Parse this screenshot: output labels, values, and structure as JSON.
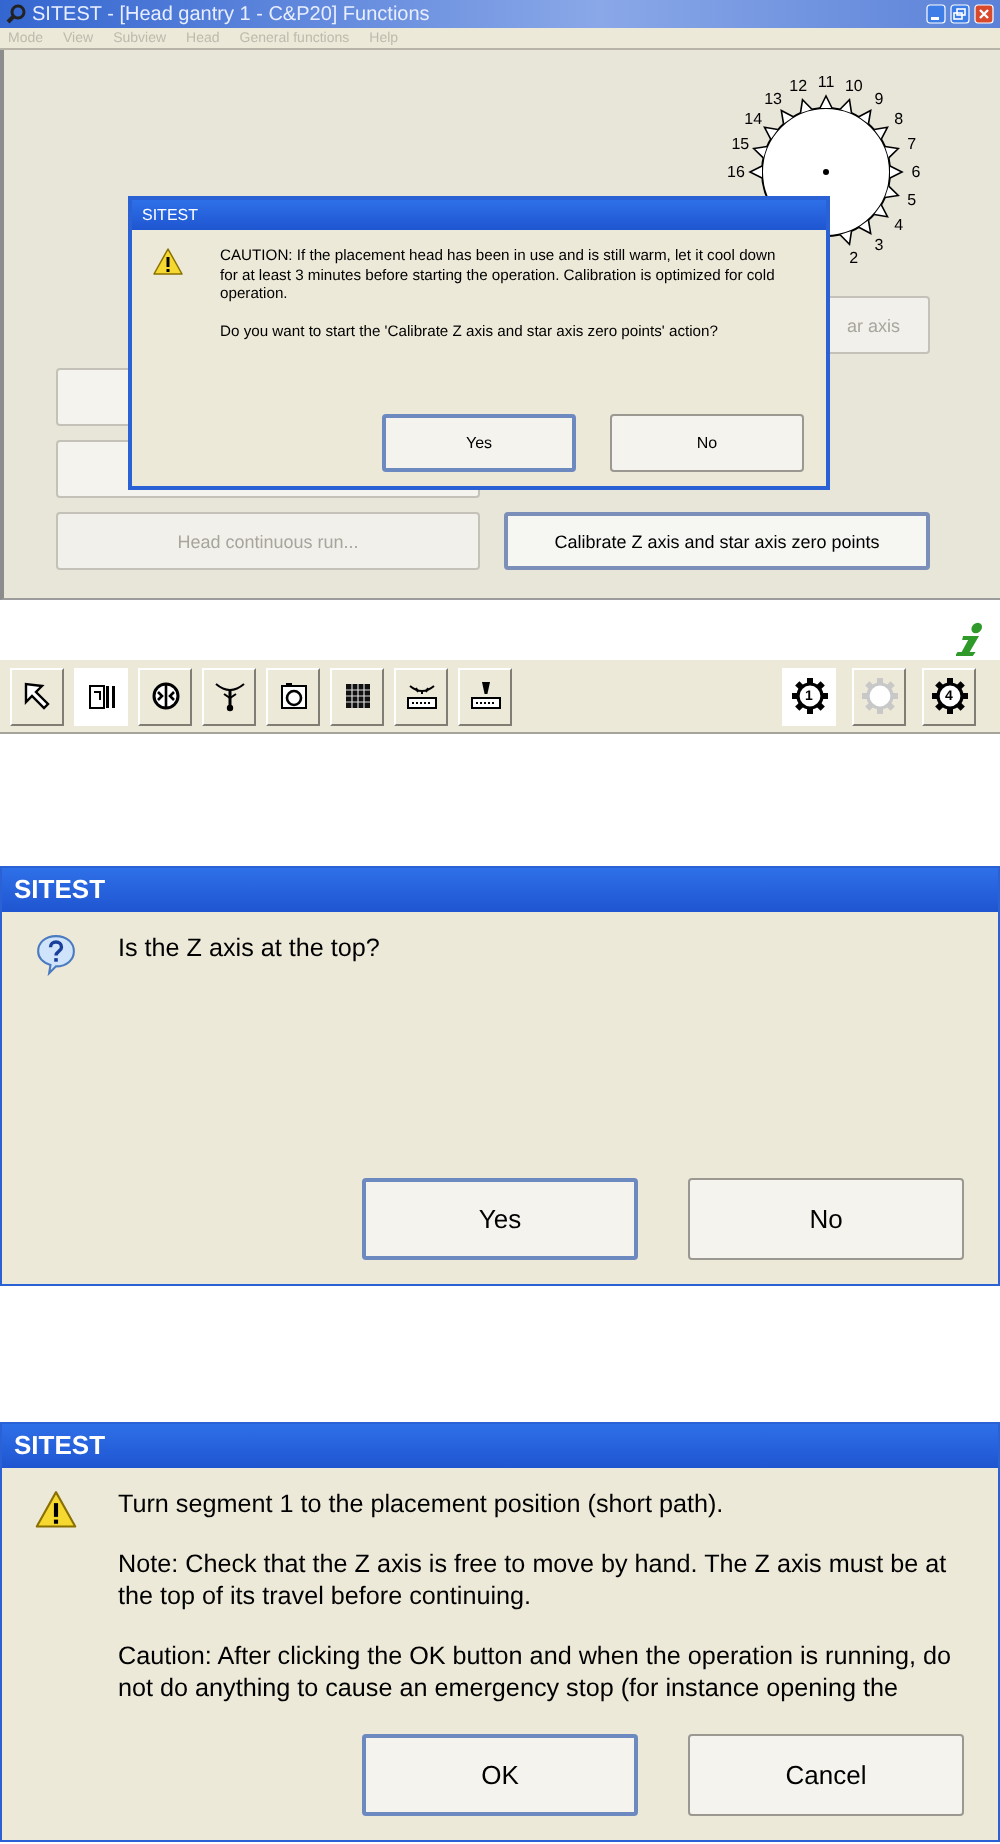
{
  "main_window": {
    "title": "SITEST - [Head gantry 1 - C&P20] Functions",
    "menu": [
      {
        "label": "Mode",
        "disabled": true
      },
      {
        "label": "View",
        "disabled": true
      },
      {
        "label": "Subview",
        "disabled": true
      },
      {
        "label": "Head",
        "disabled": true
      },
      {
        "label": "General functions",
        "disabled": true
      },
      {
        "label": "Help",
        "disabled": true
      }
    ],
    "dial_labels": [
      "16",
      "15",
      "14",
      "13",
      "12",
      "11",
      "10",
      "9",
      "8",
      "7",
      "6",
      "5",
      "4",
      "3",
      "2"
    ],
    "function_buttons": [
      {
        "label": "ar axis",
        "disabled": true,
        "default": false
      },
      {
        "label": "Head continuous run...",
        "disabled": true,
        "default": false
      },
      {
        "label": "Calibrate Z axis and star axis zero points",
        "disabled": false,
        "default": true
      }
    ],
    "toolbar": {
      "left": [
        {
          "kind": "pointer",
          "selected": false
        },
        {
          "kind": "feeder",
          "selected": true
        },
        {
          "kind": "head",
          "selected": false
        },
        {
          "kind": "star",
          "selected": false
        },
        {
          "kind": "camera",
          "selected": false
        },
        {
          "kind": "grid",
          "selected": false
        },
        {
          "kind": "conveyor-in",
          "selected": false
        },
        {
          "kind": "conveyor-out",
          "selected": false
        }
      ],
      "right": [
        {
          "kind": "gear",
          "label": "1",
          "selected": true,
          "disabled": false
        },
        {
          "kind": "gear",
          "selected": false,
          "disabled": true
        },
        {
          "kind": "gear",
          "label": "4",
          "selected": false,
          "disabled": false
        }
      ]
    },
    "dialog": {
      "title": "SITEST",
      "kind": "warning",
      "paragraphs": [
        "CAUTION: If the placement head has been in use and is still warm, let it cool down for at least 3 minutes before starting the operation. Calibration is optimized for cold operation.",
        "Do you want to start the 'Calibrate Z axis and star axis zero points' action?"
      ],
      "buttons": [
        {
          "label": "Yes",
          "default": true
        },
        {
          "label": "No",
          "default": false
        }
      ]
    }
  },
  "dialogs": [
    {
      "title": "SITEST",
      "kind": "question",
      "paragraphs": [
        "Is the Z axis at the top?"
      ],
      "buttons": [
        {
          "label": "Yes",
          "default": true
        },
        {
          "label": "No",
          "default": false
        }
      ]
    },
    {
      "title": "SITEST",
      "kind": "warning",
      "paragraphs": [
        "Turn segment 1 to the placement position (short path).",
        "Note: Check that the Z axis is free to move by hand. The Z axis must be at the top of its travel before continuing.",
        "Caution: After clicking the OK button and when the operation is running, do not do anything to cause an emergency stop (for instance opening the"
      ],
      "buttons": [
        {
          "label": "OK",
          "default": true
        },
        {
          "label": "Cancel",
          "default": false
        }
      ]
    }
  ]
}
